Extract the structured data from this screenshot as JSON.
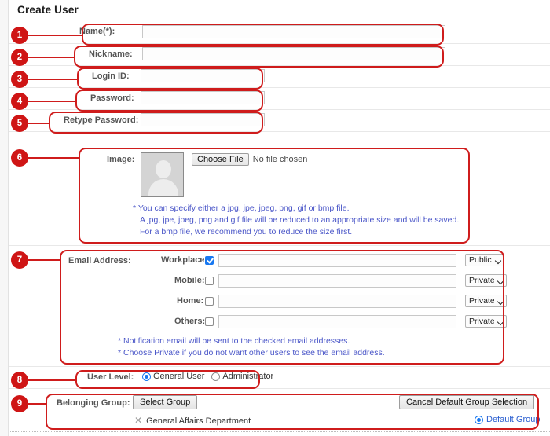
{
  "header": {
    "title": "Create User"
  },
  "fields": {
    "name": {
      "label": "Name",
      "required_mark": "(*)",
      "colon": ":",
      "value": "",
      "placeholder": ""
    },
    "nickname": {
      "label": "Nickname:",
      "value": "",
      "placeholder": ""
    },
    "login_id": {
      "label": "Login ID:",
      "value": "",
      "placeholder": ""
    },
    "password": {
      "label": "Password:",
      "value": "",
      "placeholder": ""
    },
    "retype_password": {
      "label": "Retype Password:",
      "value": "",
      "placeholder": ""
    }
  },
  "image": {
    "label": "Image:",
    "choose_button": "Choose File",
    "file_status": "No file chosen",
    "notes": [
      "* You can specify either a jpg, jpe, jpeg, png, gif or bmp file.",
      "A jpg, jpe, jpeg, png and gif file will be reduced to an appropriate size and will be saved.",
      "For a bmp file, we recommend you to reduce the size first."
    ]
  },
  "email": {
    "label": "Email Address:",
    "rows": [
      {
        "label": "Workplace:",
        "checked": true,
        "value": "",
        "visibility": "Public"
      },
      {
        "label": "Mobile:",
        "checked": false,
        "value": "",
        "visibility": "Private"
      },
      {
        "label": "Home:",
        "checked": false,
        "value": "",
        "visibility": "Private"
      },
      {
        "label": "Others:",
        "checked": false,
        "value": "",
        "visibility": "Private"
      }
    ],
    "visibility_options": [
      "Public",
      "Private"
    ],
    "notes": [
      "* Notification email will be sent to the checked email addresses.",
      "* Choose Private if you do not want other users to see the email address."
    ]
  },
  "user_level": {
    "label": "User Level:",
    "options": [
      {
        "label": "General User",
        "selected": true
      },
      {
        "label": "Administrator",
        "selected": false
      }
    ]
  },
  "belonging_group": {
    "label": "Belonging Group:",
    "select_button": "Select Group",
    "cancel_button": "Cancel Default Group Selection",
    "group_item": "General Affairs Department",
    "remove_icon": "✕",
    "default_group_label": "Default Group",
    "default_group_selected": true
  },
  "annotations": {
    "badges": [
      "1",
      "2",
      "3",
      "4",
      "5",
      "6",
      "7",
      "8",
      "9"
    ]
  },
  "colors": {
    "annotation_red": "#cf1c1c",
    "badge_red": "#cf1515",
    "note_blue": "#4a56c8",
    "link_blue": "#2b5fd0",
    "required_orange": "#e04a19",
    "accent_checkbox": "#1878f0"
  }
}
